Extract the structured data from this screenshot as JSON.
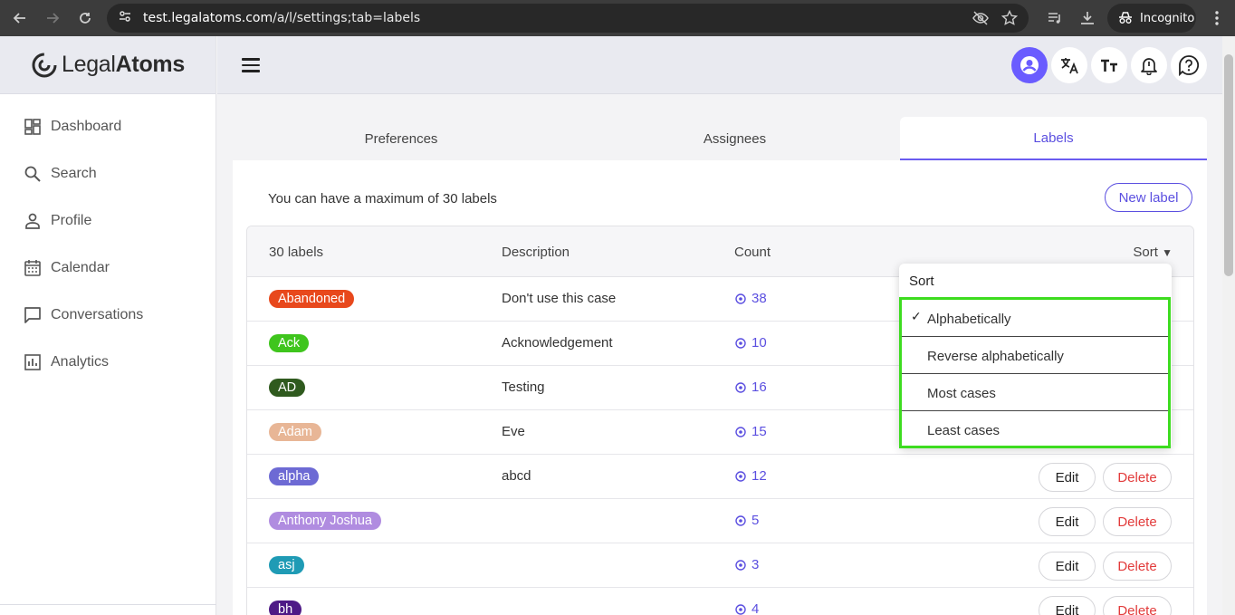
{
  "browser": {
    "url_host": "test.legalatoms.com",
    "url_path": "/a/l/settings;tab=labels",
    "incognito_label": "Incognito"
  },
  "app": {
    "brand_light": "Legal",
    "brand_bold": "Atoms"
  },
  "sidebar": {
    "items": [
      {
        "label": "Dashboard",
        "icon": "dashboard-icon"
      },
      {
        "label": "Search",
        "icon": "search-icon"
      },
      {
        "label": "Profile",
        "icon": "person-icon"
      },
      {
        "label": "Calendar",
        "icon": "calendar-icon"
      },
      {
        "label": "Conversations",
        "icon": "chat-icon"
      },
      {
        "label": "Analytics",
        "icon": "chart-icon"
      }
    ]
  },
  "settings": {
    "tabs": [
      "Preferences",
      "Assignees",
      "Labels"
    ],
    "active_tab": "Labels",
    "info_text": "You can have a maximum of 30 labels",
    "new_label_button": "New label"
  },
  "table": {
    "headers": {
      "labels": "30 labels",
      "description": "Description",
      "count": "Count",
      "sort": "Sort"
    },
    "edit_label": "Edit",
    "delete_label": "Delete",
    "rows": [
      {
        "name": "Abandoned",
        "color": "#e8481c",
        "description": "Don't use this case",
        "count": "38"
      },
      {
        "name": "Ack",
        "color": "#3fc51d",
        "description": "Acknowledgement",
        "count": "10"
      },
      {
        "name": "AD",
        "color": "#2f5a1e",
        "description": "Testing",
        "count": "16"
      },
      {
        "name": "Adam",
        "color": "#e8b696",
        "description": "Eve",
        "count": "15"
      },
      {
        "name": "alpha",
        "color": "#6d6ad4",
        "description": "abcd",
        "count": "12"
      },
      {
        "name": "Anthony Joshua",
        "color": "#b08ce0",
        "description": "",
        "count": "5"
      },
      {
        "name": "asj",
        "color": "#1f9bb5",
        "description": "",
        "count": "3"
      },
      {
        "name": "bh",
        "color": "#4e1a86",
        "description": "",
        "count": "4"
      }
    ]
  },
  "sort_menu": {
    "title": "Sort",
    "options": [
      "Alphabetically",
      "Reverse alphabetically",
      "Most cases",
      "Least cases"
    ],
    "selected": "Alphabetically",
    "highlight_color": "#3ddc1f"
  }
}
